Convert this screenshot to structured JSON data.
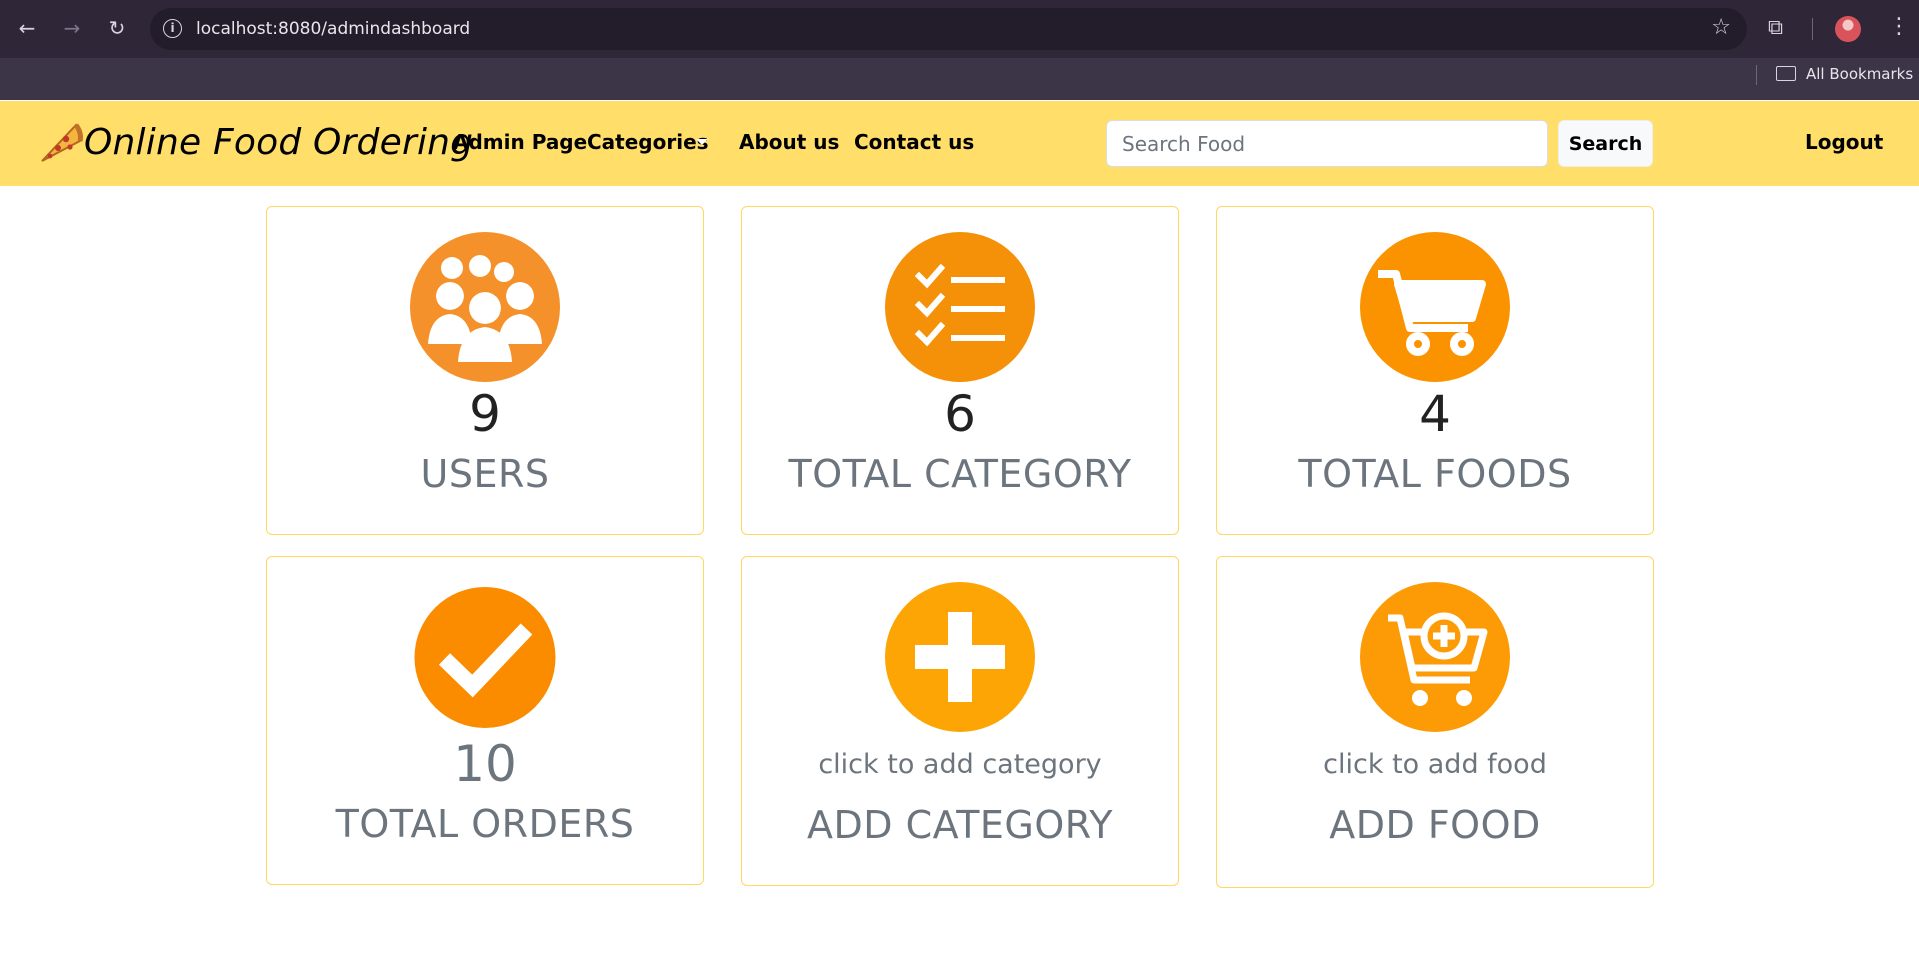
{
  "browser": {
    "url": "localhost:8080/admindashboard",
    "bookmarks_label": "All Bookmarks",
    "icons": [
      "back-icon",
      "forward-icon",
      "reload-icon",
      "info-icon",
      "star-icon",
      "extensions-icon",
      "profile-avatar",
      "menu-icon",
      "folder-icon"
    ]
  },
  "navbar": {
    "brand": "Online Food Ordering",
    "links": {
      "admin": "Admin Page",
      "categories": "Categories",
      "about": "About us",
      "contact": "Contact us"
    },
    "search_placeholder": "Search Food",
    "search_button": "Search",
    "logout": "Logout",
    "background": "#ffde6a"
  },
  "cards": {
    "users": {
      "count": "9",
      "title": "USERS",
      "icon": "users-icon"
    },
    "category": {
      "count": "6",
      "title": "TOTAL CATEGORY",
      "icon": "checklist-icon"
    },
    "foods": {
      "count": "4",
      "title": "TOTAL FOODS",
      "icon": "cart-icon"
    },
    "orders": {
      "count": "10",
      "title": "TOTAL ORDERS",
      "icon": "check-icon"
    },
    "add_category": {
      "hint": "click to add category",
      "title": "ADD CATEGORY",
      "icon": "plus-icon"
    },
    "add_food": {
      "hint": "click to add food",
      "title": "ADD FOOD",
      "icon": "cart-add-icon"
    }
  },
  "colors": {
    "accent_orange": "#f7921e",
    "card_border": "#ffd761",
    "muted_text": "#6c757d"
  }
}
